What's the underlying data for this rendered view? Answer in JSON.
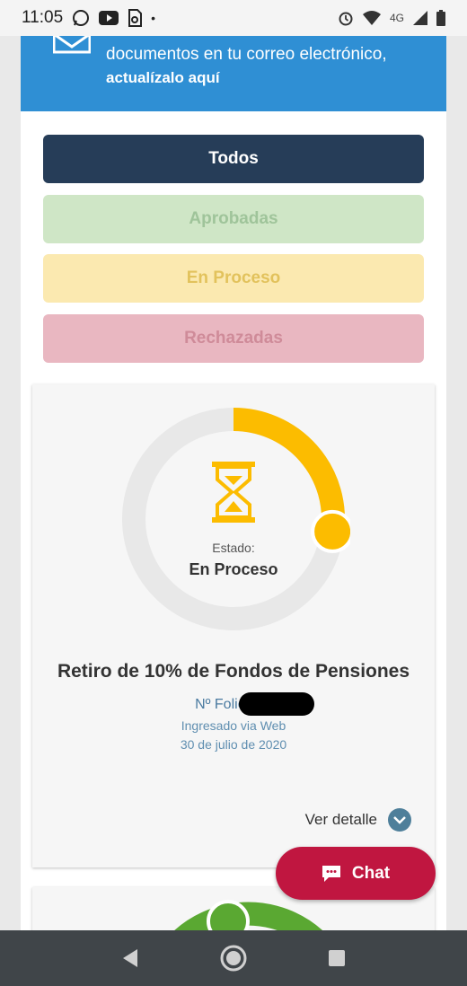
{
  "status_bar": {
    "time": "11:05",
    "network": "4G",
    "icons": [
      "whatsapp-icon",
      "youtube-icon",
      "sim-update-icon",
      "dot-icon",
      "alarm-icon",
      "wifi-icon",
      "signal-icon",
      "battery-icon"
    ]
  },
  "banner": {
    "line1": "documentos en tu correo electrónico,",
    "link": "actualízalo aquí",
    "icon": "mail-icon"
  },
  "filters": {
    "all": "Todos",
    "approved": "Aprobadas",
    "in_process": "En Proceso",
    "rejected": "Rechazadas"
  },
  "card": {
    "status_label": "Estado:",
    "status_value": "En Proceso",
    "title": "Retiro de 10% de Fondos de Pensiones",
    "folio": "Nº Folio: R5",
    "ingresado": "Ingresado via Web",
    "fecha": "30 de julio de 2020",
    "detail": "Ver detalle",
    "progress_fraction": 0.27,
    "colors": {
      "progress": "#fcbc00",
      "track": "#e8e8e8",
      "icon": "#fcbc00"
    }
  },
  "chat": {
    "label": "Chat"
  },
  "colors": {
    "banner": "#2f8fd4",
    "todos": "#263d58",
    "aprobadas": "#cfe6c6",
    "en_proceso": "#fbe9b0",
    "rechazadas": "#e9b7c1",
    "chat": "#c01640",
    "second_card_ring": "#5aa832"
  }
}
